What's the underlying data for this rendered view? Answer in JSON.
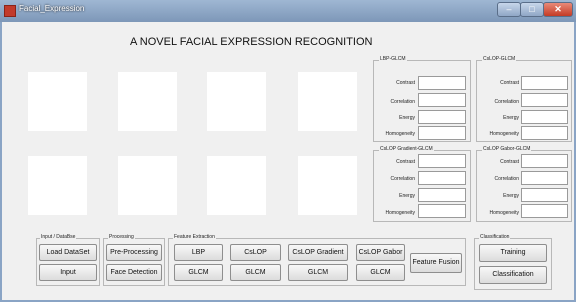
{
  "window": {
    "title": "Facial_Expression",
    "minimize_glyph": "–",
    "maximize_glyph": "□",
    "close_glyph": "✕"
  },
  "heading": "A NOVEL FACIAL EXPRESSION RECOGNITION",
  "panels": [
    {
      "title": "LBP-GLCM",
      "fields": [
        {
          "label": "Contrast",
          "value": ""
        },
        {
          "label": "Correlation",
          "value": ""
        },
        {
          "label": "Energy",
          "value": ""
        },
        {
          "label": "Homogeneity",
          "value": ""
        }
      ]
    },
    {
      "title": "CsLOP-GLCM",
      "fields": [
        {
          "label": "Contrast",
          "value": ""
        },
        {
          "label": "Correlation",
          "value": ""
        },
        {
          "label": "Energy",
          "value": ""
        },
        {
          "label": "Homogeneity",
          "value": ""
        }
      ]
    },
    {
      "title": "CsLOP Gradient-GLCM",
      "fields": [
        {
          "label": "Contrast",
          "value": ""
        },
        {
          "label": "Correlation",
          "value": ""
        },
        {
          "label": "Energy",
          "value": ""
        },
        {
          "label": "Homogeneity",
          "value": ""
        }
      ]
    },
    {
      "title": "CsLOP Gabor-GLCM",
      "fields": [
        {
          "label": "Contrast",
          "value": ""
        },
        {
          "label": "Correlation",
          "value": ""
        },
        {
          "label": "Energy",
          "value": ""
        },
        {
          "label": "Homogeneity",
          "value": ""
        }
      ]
    }
  ],
  "groups": {
    "input": {
      "title": "Input / DataBse",
      "load_dataset": "Load DataSet",
      "input": "Input"
    },
    "processing": {
      "title": "Processing",
      "preprocessing": "Pre-Processing",
      "face_detection": "Face Detection"
    },
    "feature_extraction": {
      "title": "Feature Extraction",
      "lbp": "LBP",
      "cslop": "CsLOP",
      "cslop_gradient": "CsLOP Gradient",
      "cslop_gabor": "CsLOP Gabor",
      "glcm1": "GLCM",
      "glcm2": "GLCM",
      "glcm3": "GLCM",
      "glcm4": "GLCM",
      "feature_fusion": "Feature Fusion"
    },
    "classification": {
      "title": "Classification",
      "training": "Training",
      "classification": "Classification"
    }
  }
}
